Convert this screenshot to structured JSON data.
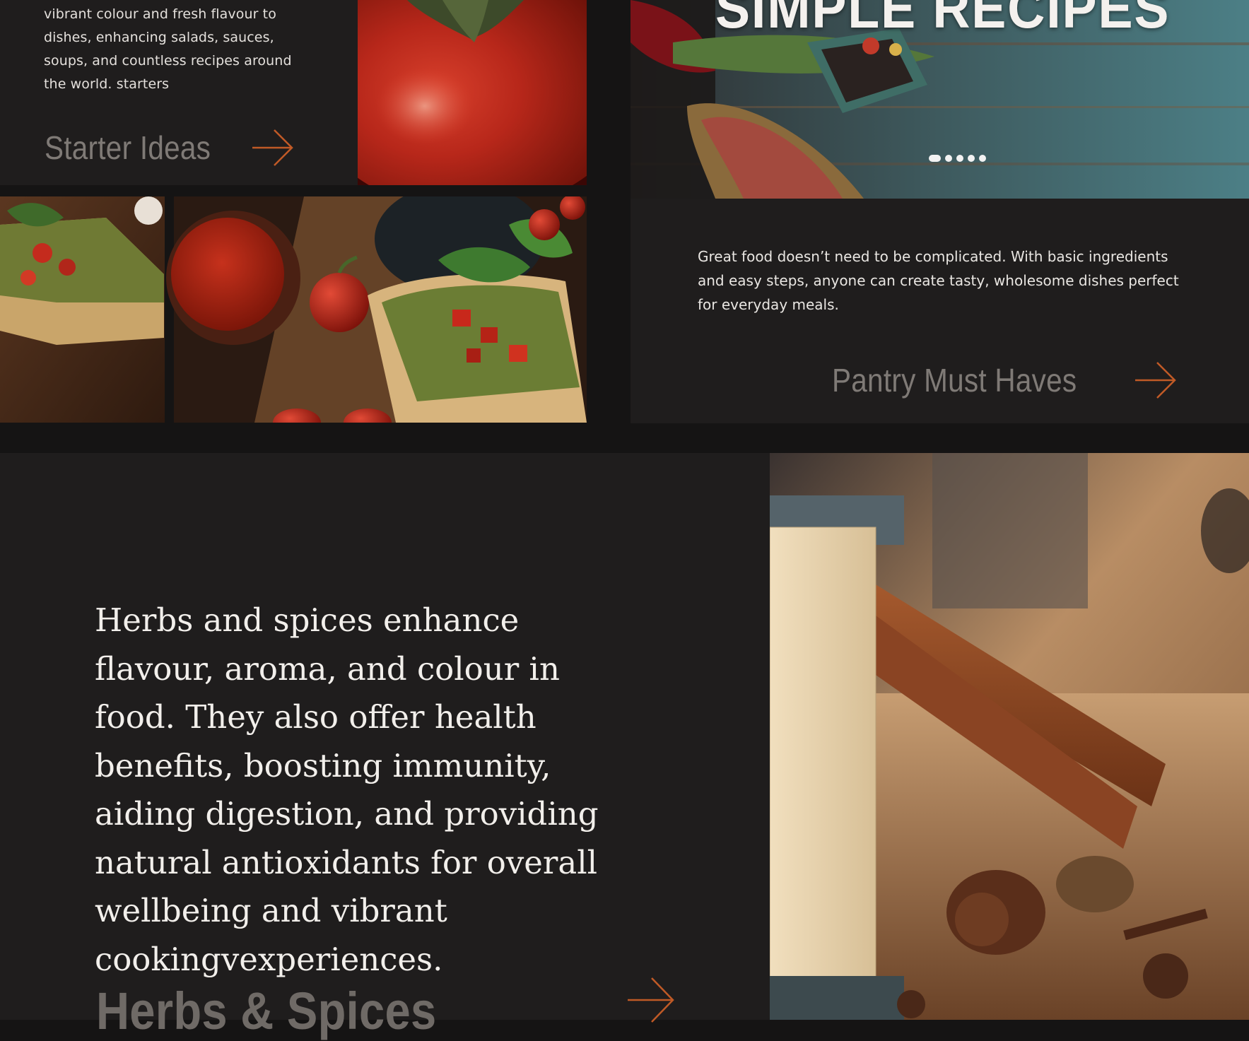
{
  "starters": {
    "description": "vibrant colour and fresh flavour to dishes, enhancing salads, sauces, soups, and countless recipes around the world. starters",
    "cta_label": "Starter Ideas"
  },
  "hero": {
    "title": "SIMPLE RECIPES",
    "slides_count": 5,
    "active_slide": 1
  },
  "pantry": {
    "description": "Great food doesn’t need to be complicated. With basic ingredients and easy steps, anyone can create tasty, wholesome dishes perfect for everyday meals.",
    "cta_label": "Pantry Must Haves"
  },
  "herbs": {
    "description": "Herbs and spices enhance flavour, aroma, and colour in food. They also offer health benefits, boosting immunity, aiding digestion, and providing natural antioxidants for overall wellbeing and vibrant cookingvexperiences.",
    "cta_label": "Herbs & Spices"
  },
  "colors": {
    "page_background": "#151414",
    "panel_background": "#1f1d1d",
    "cta_text": "#7f7a76",
    "arrow_accent": "#c05a26"
  },
  "icons": {
    "arrow": "arrow-right-icon"
  }
}
